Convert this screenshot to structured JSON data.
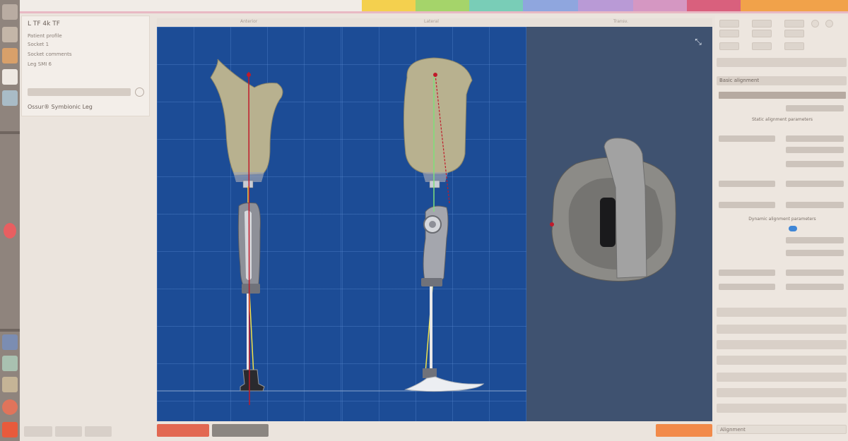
{
  "app": {
    "colors": {
      "viewport_bg": "#1c4c96",
      "top_view_bg": "#3f5270",
      "grid": "#5a8cd2",
      "socket": "#b8b18f",
      "load_line_red": "#c01a2a",
      "load_line_yellow": "#f0e24a",
      "load_line_green": "#7ee07a",
      "accent_red": "#e26852",
      "accent_orange": "#f28a4a"
    }
  },
  "topbar": {
    "segments": [
      {
        "color": "#f4d04e"
      },
      {
        "color": "#a5d46a"
      },
      {
        "color": "#79cdb7"
      },
      {
        "color": "#8fa6de"
      },
      {
        "color": "#b99ad6"
      },
      {
        "color": "#d597c2"
      },
      {
        "color": "#d9607d"
      },
      {
        "color": "#f1a24a"
      }
    ]
  },
  "left_toolbar": {
    "icons": [
      {
        "name": "home-icon",
        "color": "#b9aca2"
      },
      {
        "name": "patient-icon",
        "color": "#c4b6a8"
      },
      {
        "name": "avatar-icon",
        "color": "#d8a06a"
      },
      {
        "name": "document-icon",
        "color": "#eee8e2"
      },
      {
        "name": "scanner-icon",
        "color": "#a9bcc7"
      },
      {
        "name": "shield-icon",
        "color": "#e85f61"
      },
      {
        "name": "filter-icon",
        "color": "#7b8db2"
      },
      {
        "name": "layout-icon",
        "color": "#a9c1b0"
      },
      {
        "name": "grid-icon",
        "color": "#c5b496"
      },
      {
        "name": "settings-icon",
        "color": "#e0745b"
      },
      {
        "name": "power-icon",
        "color": "#e85a3c"
      }
    ]
  },
  "patient": {
    "title": "L TF 4k TF",
    "lines": [
      "Patient profile",
      "Socket 1",
      "Socket comments",
      "Leg SMI 6"
    ],
    "device_label": "",
    "device_select": "",
    "device_name": "Ossur® Symbionic Leg"
  },
  "viewport": {
    "headers": [
      "Anterior",
      "Lateral",
      "Transv."
    ]
  },
  "buttons": {
    "left_red": "",
    "left_gray": "",
    "right_orange": ""
  },
  "right_panel": {
    "accordions": [
      "",
      "Basic alignment",
      "",
      "",
      "",
      "",
      "",
      "",
      "",
      ""
    ],
    "sections": [
      "Static alignment parameters",
      "Dynamic alignment parameters"
    ],
    "header_bar": "",
    "rows": [
      {
        "label": "",
        "value": ""
      },
      {
        "label": "",
        "value": ""
      },
      {
        "label": "",
        "value": ""
      },
      {
        "label": "",
        "value": ""
      },
      {
        "label": "",
        "value": ""
      },
      {
        "label": "",
        "value": ""
      },
      {
        "label": "",
        "value": ""
      },
      {
        "label": "",
        "value": ""
      },
      {
        "label": "",
        "value": ""
      },
      {
        "label": "",
        "value": ""
      }
    ],
    "bottom_select": "Alignment"
  }
}
